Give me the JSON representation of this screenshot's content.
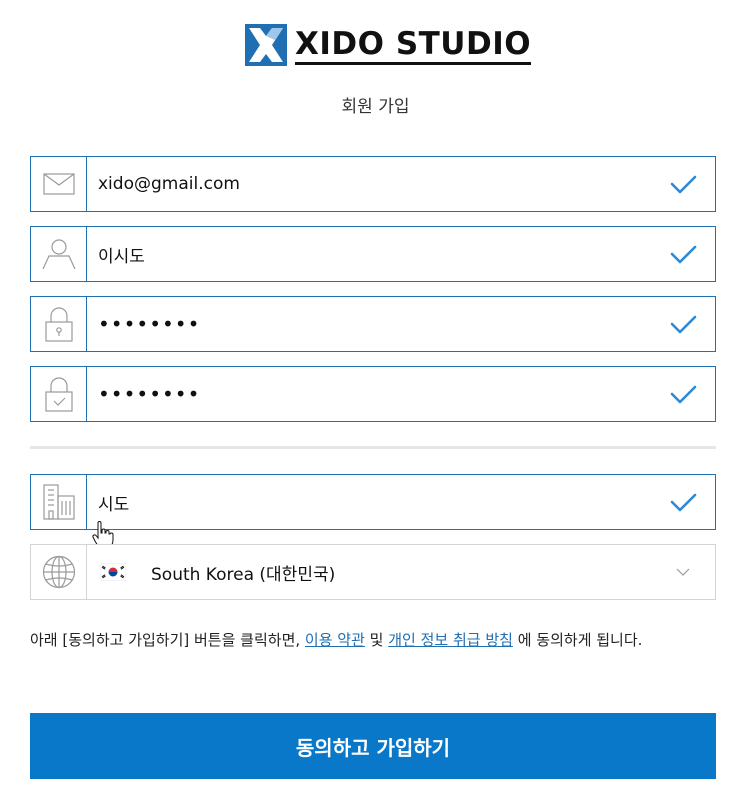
{
  "logo": {
    "text": "XIDO STUDIO",
    "color": "#1f6fb2"
  },
  "subtitle": "회원 가입",
  "fields": {
    "email": {
      "value": "xido@gmail.com",
      "icon": "mail-icon"
    },
    "name": {
      "value": "이시도",
      "icon": "user-icon"
    },
    "password": {
      "value": "••••••••",
      "icon": "lock-icon"
    },
    "password_confirm": {
      "value": "••••••••",
      "icon": "lock-check-icon"
    },
    "city": {
      "value": "시도",
      "icon": "building-icon"
    },
    "country": {
      "value": "South Korea (대한민국)",
      "icon": "globe-icon",
      "flag": "south-korea-flag-icon"
    }
  },
  "terms": {
    "prefix": "아래 [동의하고 가입하기] 버튼을 클릭하면, ",
    "link1": "이용 약관",
    "middle": " 및 ",
    "link2": "개인 정보 취급 방침",
    "suffix": " 에 동의하게 됩니다."
  },
  "submit_label": "동의하고 가입하기",
  "colors": {
    "accent": "#1f6fb2",
    "button": "#0a78c8",
    "check": "#2d8ad6"
  }
}
